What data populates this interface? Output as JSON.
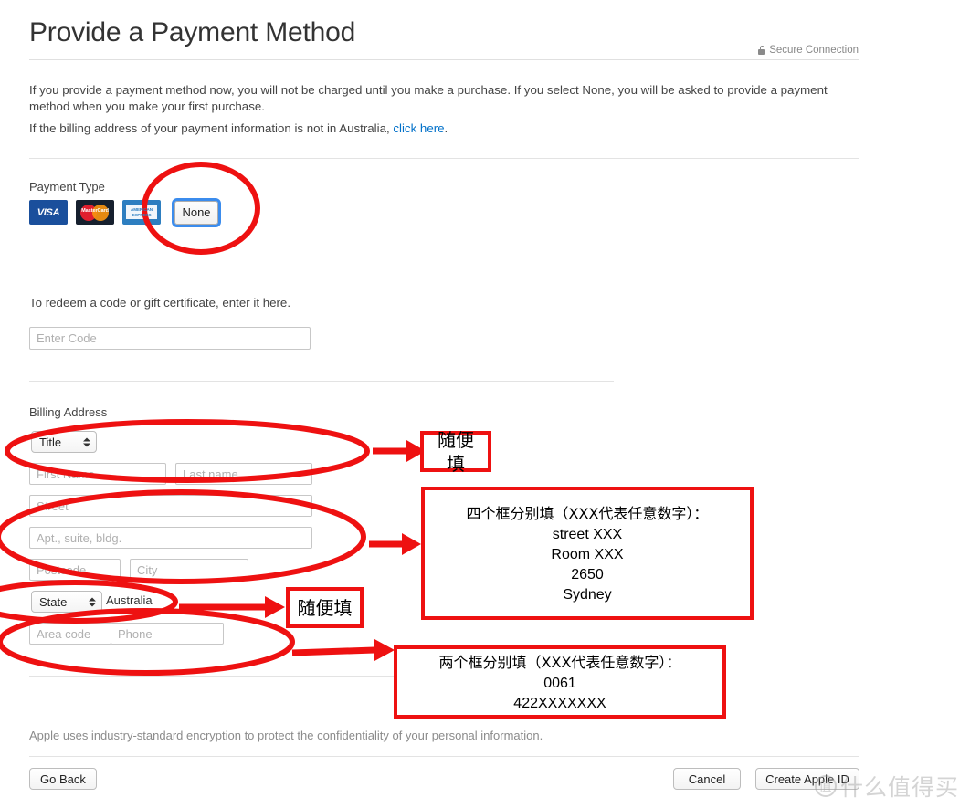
{
  "header": {
    "title": "Provide a Payment Method",
    "secure_label": "Secure Connection",
    "lock_icon": "lock-icon"
  },
  "intro": {
    "line1": "If you provide a payment method now, you will not be charged until you make a purchase. If you select None, you will be asked to provide a payment method when you make your first purchase.",
    "line2_pre": "If the billing address of your payment information is not in Australia, ",
    "line2_link": "click here",
    "line2_post": "."
  },
  "payment": {
    "section_label": "Payment Type",
    "cards": [
      {
        "name": "visa-card-icon",
        "label": "VISA"
      },
      {
        "name": "mastercard-card-icon",
        "label": "MasterCard"
      },
      {
        "name": "amex-card-icon",
        "label_top": "AMERICAN",
        "label_bottom": "EXPRESS"
      }
    ],
    "none_label": "None",
    "selected": "None"
  },
  "redeem": {
    "text": "To redeem a code or gift certificate, enter it here.",
    "input_placeholder": "Enter Code",
    "input_value": ""
  },
  "billing": {
    "section_label": "Billing Address",
    "title_select": "Title",
    "first_name_placeholder": "First Name",
    "last_name_placeholder": "Last name",
    "street_placeholder": "Street",
    "apt_placeholder": "Apt., suite, bldg.",
    "postcode_placeholder": "Postcode",
    "city_placeholder": "City",
    "state_select": "State",
    "country": "Australia",
    "area_code_placeholder": "Area code",
    "phone_placeholder": "Phone"
  },
  "footer": {
    "note": "Apple uses industry-standard encryption to protect the confidentiality of your personal information.",
    "go_back": "Go Back",
    "cancel": "Cancel",
    "create": "Create Apple ID"
  },
  "annotations": [
    {
      "name": "annotation-name-fields",
      "kind": "box-small",
      "text": "随便填"
    },
    {
      "name": "annotation-address-fields",
      "kind": "box-large",
      "head": "四个框分别填（XXX代表任意数字）：",
      "lines": [
        "street XXX",
        "Room XXX",
        "2650",
        "Sydney"
      ]
    },
    {
      "name": "annotation-state-field",
      "kind": "box-small",
      "text": "随便填"
    },
    {
      "name": "annotation-phone-fields",
      "kind": "box-large",
      "head": "两个框分别填（XXX代表任意数字）：",
      "lines": [
        "0061",
        "422XXXXXXX"
      ]
    }
  ],
  "watermark": {
    "mark": "值",
    "text": "什么值得买"
  },
  "colors": {
    "annotation_red": "#ee1111",
    "link_blue": "#0070c9",
    "focus_blue": "#3b8ced",
    "visa_blue": "#1a4f9c",
    "amex_blue": "#2d7ec0"
  }
}
